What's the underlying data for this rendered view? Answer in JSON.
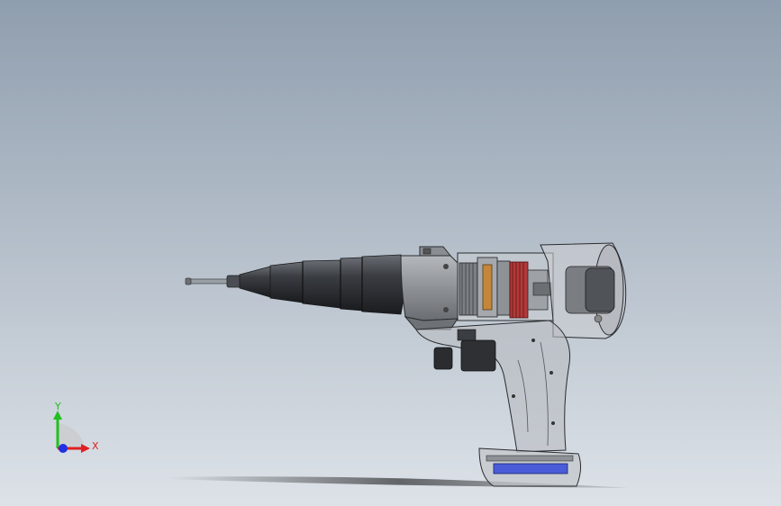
{
  "viewport": {
    "background_top": "#8f9eae",
    "background_bottom": "#dde2e8"
  },
  "triad": {
    "x_label": "X",
    "y_label": "Y",
    "x_color": "#e02020",
    "y_color": "#20c020",
    "z_color": "#2030e0"
  },
  "model": {
    "nozzle_color": "#2c2f33",
    "housing_color": "#8c9096",
    "rotor_color": "#b23a3a",
    "battery_band_color": "#4a5cd8"
  }
}
